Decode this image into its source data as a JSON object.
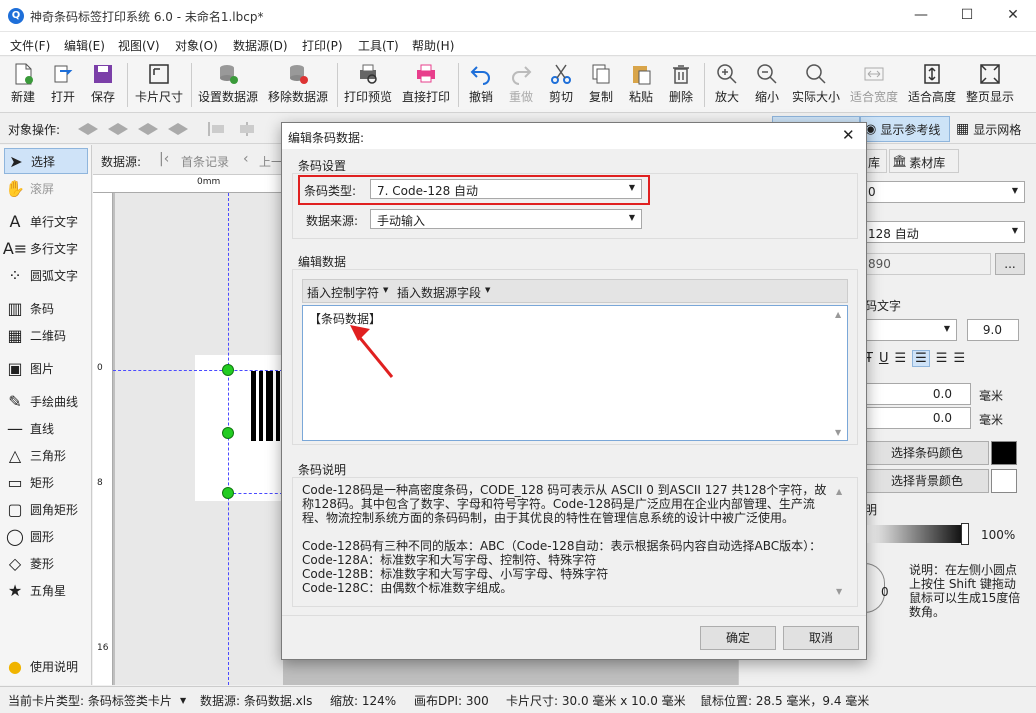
{
  "app": {
    "title": "神奇条码标签打印系统 6.0 - 未命名1.lbcp*",
    "window_buttons": {
      "minimize": "—",
      "maximize": "☐",
      "close": "✕"
    }
  },
  "menu": [
    "文件(F)",
    "编辑(E)",
    "视图(V)",
    "对象(O)",
    "数据源(D)",
    "打印(P)",
    "工具(T)",
    "帮助(H)"
  ],
  "toolbar": [
    "新建",
    "打开",
    "保存",
    "卡片尺寸",
    "设置数据源",
    "移除数据源",
    "打印预览",
    "直接打印",
    "撤销",
    "重做",
    "剪切",
    "复制",
    "粘贴",
    "删除",
    "放大",
    "缩小",
    "实际大小",
    "适合宽度",
    "适合高度",
    "整页显示"
  ],
  "objbar": {
    "label": "对象操作:",
    "show_guides": "显示参考线",
    "show_grid": "显示网格"
  },
  "left_tools": [
    "选择",
    "滚屏",
    "单行文字",
    "多行文字",
    "圆弧文字",
    "条码",
    "二维码",
    "图片",
    "手绘曲线",
    "直线",
    "三角形",
    "矩形",
    "圆角矩形",
    "圆形",
    "菱形",
    "五角星",
    "使用说明"
  ],
  "datasrc": {
    "label": "数据源:",
    "first": "首条记录",
    "prev": "上一"
  },
  "ruler": {
    "top0": "0mm",
    "left0": "0",
    "left8": "8",
    "left16": "16"
  },
  "right_panel": {
    "tabs": [
      "库",
      "素材库"
    ],
    "field1": "0",
    "barcode_type": "128 自动",
    "data_value": "890",
    "more": "...",
    "text_label": "码文字",
    "font_size": "9.0",
    "offset1": "0.0",
    "offset2": "0.0",
    "unit": "毫米",
    "bar_color_btn": "选择条码颜色",
    "bg_color_btn": "选择背景颜色",
    "transparency_label": "明",
    "transparency_value": "100%",
    "rotation_value": "0",
    "hint": "说明：在左侧小圆点上按住 Shift 键拖动鼠标可以生成15度倍数角。"
  },
  "dialog": {
    "title": "编辑条码数据:",
    "group_settings": "条码设置",
    "type_label": "条码类型:",
    "type_value": "7. Code-128 自动",
    "source_label": "数据来源:",
    "source_value": "手动输入",
    "group_edit": "编辑数据",
    "insert_control": "插入控制字符",
    "insert_field": "插入数据源字段",
    "editor_text": "【条码数据】",
    "group_desc": "条码说明",
    "desc_lines": [
      "Code-128码是一种高密度条码，CODE_128 码可表示从 ASCII 0 到ASCII 127 共128个字符，故称128码。其中包含了数字、字母和符号字符。Code-128码是广泛应用在企业内部管理、生产流程、物流控制系统方面的条码码制，由于其优良的特性在管理信息系统的设计中被广泛使用。",
      "Code-128码有三种不同的版本：ABC（Code-128自动：表示根据条码内容自动选择ABC版本）：",
      "Code-128A：标准数字和大写字母、控制符、特殊字符",
      "Code-128B：标准数字和大写字母、小写字母、特殊字符",
      "Code-128C：由偶数个标准数字组成。"
    ],
    "ok": "确定",
    "cancel": "取消"
  },
  "status": {
    "card_type": "当前卡片类型: 条码标签类卡片",
    "datasource": "数据源: 条码数据.xls",
    "zoom": "缩放: 124%",
    "dpi": "画布DPI: 300",
    "card_size": "卡片尺寸: 30.0 毫米 x 10.0 毫米",
    "mouse": "鼠标位置: 28.5 毫米，9.4 毫米"
  },
  "colors": {
    "accent_blue": "#1e6fd9",
    "highlight_red": "#e02020",
    "handle_green": "#22cc22",
    "selected_tool": "#cfe3f8"
  }
}
